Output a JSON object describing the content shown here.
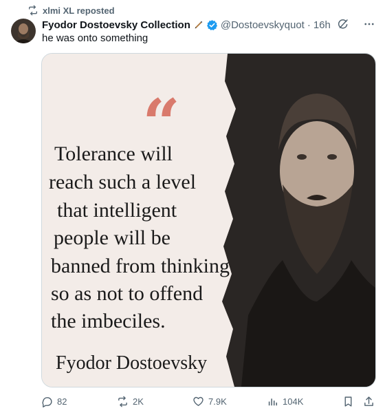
{
  "repost": {
    "label": "xlmi XL reposted",
    "icon": "repost-icon"
  },
  "author": {
    "display_name": "Fyodor Dostoevsky Collection",
    "handle": "@Dostoevskyquot",
    "time": "16h",
    "avatar_icon": "avatar-portrait",
    "verified_color": "#1d9bf0"
  },
  "tweet": {
    "text": "he was onto something"
  },
  "media": {
    "quote_mark": "“",
    "quote_lines": [
      "Tolerance will",
      "reach such a level",
      "that intelligent",
      "people will be",
      "banned from thinking",
      "so as not to offend",
      "the imbeciles."
    ],
    "author": "Fyodor Dostoevsky",
    "quote_mark_color": "#d97a6c",
    "background_color": "#f3ece8"
  },
  "actions": {
    "replies": "82",
    "reposts": "2K",
    "likes": "7.9K",
    "views": "104K"
  }
}
